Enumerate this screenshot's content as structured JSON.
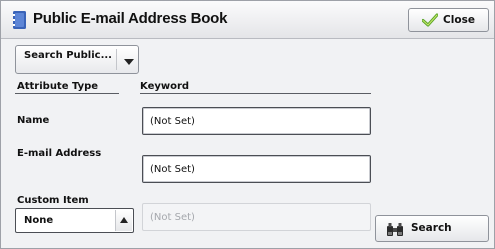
{
  "window": {
    "title": "Public E-mail Address Book",
    "close_label": "Close"
  },
  "search_source": {
    "selected": "Search Public..."
  },
  "columns": {
    "attribute_type": "Attribute Type",
    "keyword": "Keyword"
  },
  "fields": {
    "name": {
      "label": "Name",
      "value": "(Not Set)"
    },
    "email": {
      "label": "E-mail Address",
      "value": "(Not Set)"
    },
    "custom_item": {
      "label": "Custom Item",
      "selected": "None",
      "value": "(Not Set)",
      "enabled": false
    }
  },
  "actions": {
    "search_label": "Search"
  },
  "icons": {
    "title": "address-book-icon",
    "close": "checkmark-icon",
    "search": "binoculars-icon"
  },
  "colors": {
    "title_icon": "#3a63b8",
    "close_check": "#5aa62a"
  }
}
